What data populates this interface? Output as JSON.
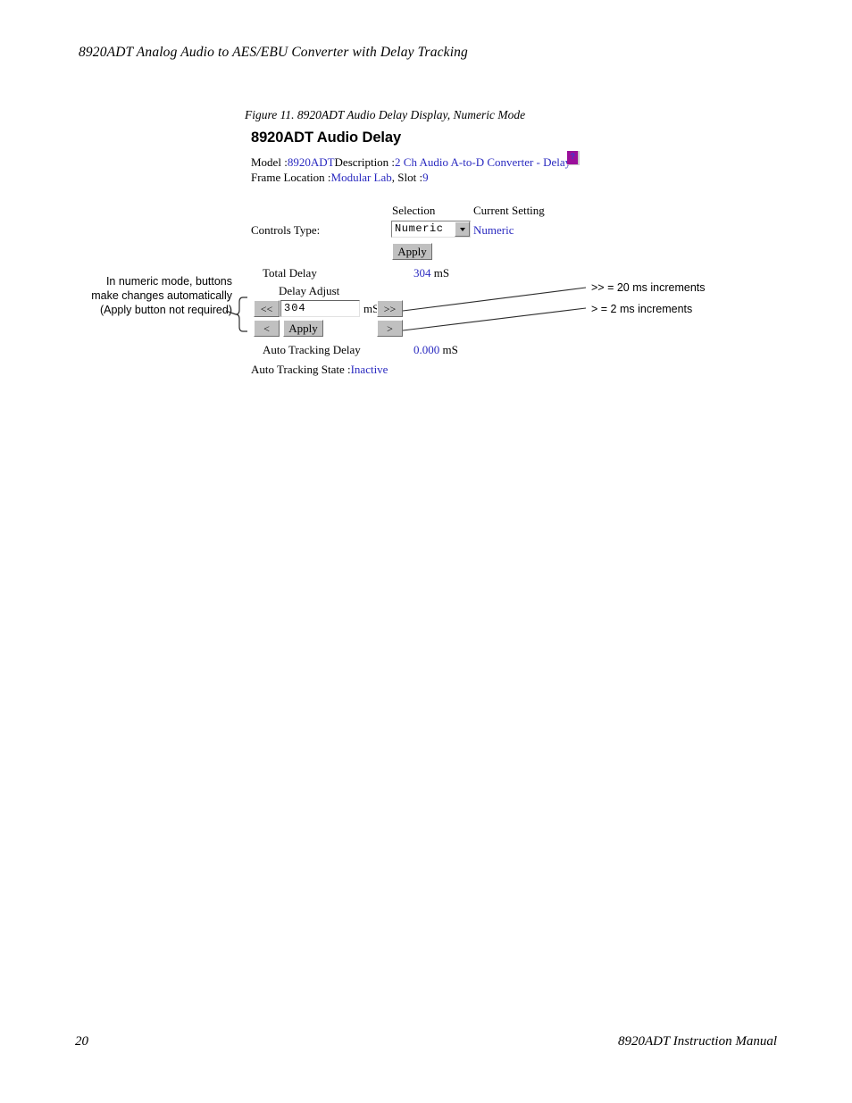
{
  "document": {
    "running_header": "8920ADT Analog Audio to AES/EBU Converter with Delay Tracking",
    "figure_caption": "Figure 11.  8920ADT Audio Delay Display, Numeric Mode",
    "footer_page_number": "20",
    "footer_title": "8920ADT Instruction Manual"
  },
  "colors": {
    "link_blue": "#2a2ac0",
    "help_button_purple": "#9a0f9a",
    "button_face": "#c0c0c0"
  },
  "screenshot": {
    "title": "8920ADT Audio Delay",
    "identity": {
      "model_key": "Model :",
      "model_value": "8920ADT",
      "description_key": "Description :",
      "description_value": "2 Ch Audio A-to-D Converter - Delay",
      "help_icon_label": "?",
      "frame_location_key": "Frame Location :",
      "frame_location_value": "Modular Lab",
      "slot_key": ", Slot :",
      "slot_value": "9"
    },
    "column_headers": {
      "selection": "Selection",
      "current_setting": "Current Setting"
    },
    "controls_type": {
      "label": "Controls Type:",
      "selected_option": "Numeric",
      "options": [
        "Numeric"
      ],
      "current_setting": "Numeric",
      "apply_label": "Apply"
    },
    "total_delay": {
      "label": "Total Delay",
      "value": "304",
      "unit": "mS"
    },
    "delay_adjust": {
      "label": "Delay Adjust",
      "input_value": "304",
      "unit": "mS",
      "decrement_coarse_label": "<<",
      "increment_coarse_label": ">>",
      "decrement_fine_label": "<",
      "increment_fine_label": ">",
      "apply_label": "Apply"
    },
    "auto_tracking_delay": {
      "label": "Auto Tracking Delay",
      "value": "0.000",
      "unit": "mS"
    },
    "auto_tracking_state": {
      "label": "Auto Tracking State :",
      "value": "Inactive"
    }
  },
  "annotations": {
    "left_note": "In numeric mode, buttons make changes automatically (Apply button not required)",
    "right_note_coarse": ">> = 20 ms increments",
    "right_note_fine": "> = 2 ms increments"
  }
}
